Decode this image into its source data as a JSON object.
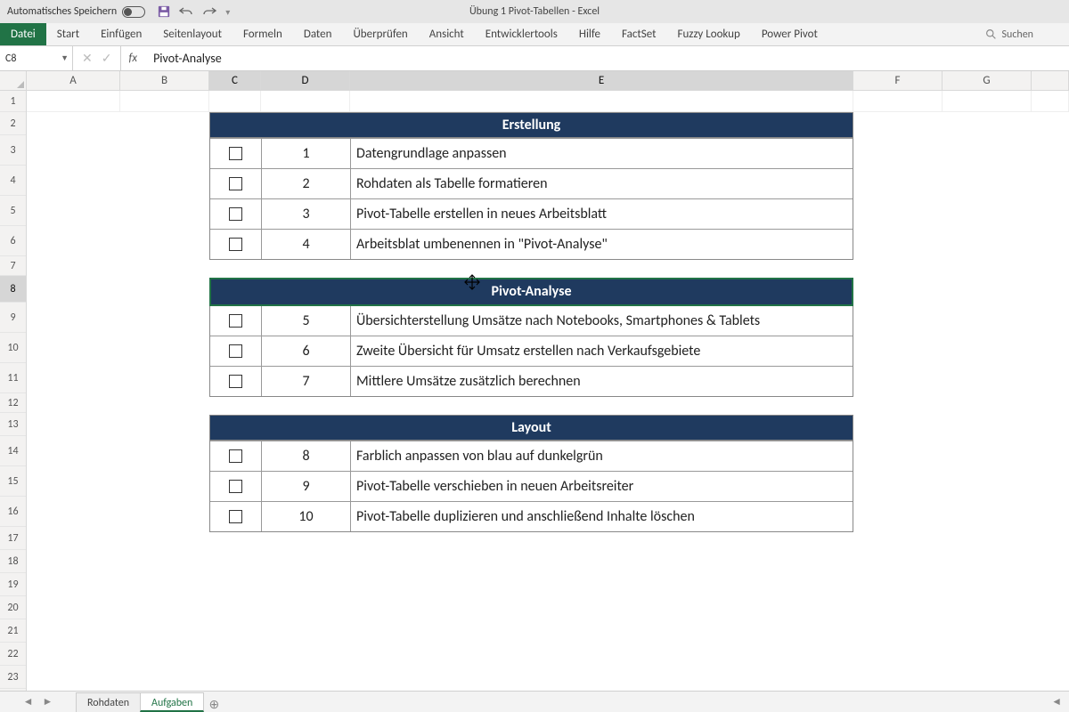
{
  "titlebar": {
    "autosave_label": "Automatisches Speichern",
    "autosave_on": false,
    "doc_title": "Übung 1 Pivot-Tabellen  -  Excel"
  },
  "ribbon": {
    "file_label": "Datei",
    "tabs": [
      "Start",
      "Einfügen",
      "Seitenlayout",
      "Formeln",
      "Daten",
      "Überprüfen",
      "Ansicht",
      "Entwicklertools",
      "Hilfe",
      "FactSet",
      "Fuzzy Lookup",
      "Power Pivot"
    ],
    "search_placeholder": "Suchen"
  },
  "formula": {
    "cell_ref": "C8",
    "value": "Pivot-Analyse"
  },
  "columns": [
    "A",
    "B",
    "C",
    "D",
    "E",
    "F",
    "G"
  ],
  "rows": [
    "1",
    "2",
    "3",
    "4",
    "5",
    "6",
    "7",
    "8",
    "9",
    "10",
    "11",
    "12",
    "13",
    "14",
    "15",
    "16",
    "17",
    "18",
    "19",
    "20",
    "21",
    "22",
    "23"
  ],
  "tables": {
    "t1": {
      "title": "Erstellung",
      "rows": [
        {
          "num": "1",
          "text": "Datengrundlage anpassen"
        },
        {
          "num": "2",
          "text": "Rohdaten als Tabelle formatieren"
        },
        {
          "num": "3",
          "text": "Pivot-Tabelle erstellen in neues Arbeitsblatt"
        },
        {
          "num": "4",
          "text": "Arbeitsblat umbenennen in \"Pivot-Analyse\""
        }
      ]
    },
    "t2": {
      "title": "Pivot-Analyse",
      "rows": [
        {
          "num": "5",
          "text": "Übersichterstellung Umsätze nach Notebooks, Smartphones & Tablets"
        },
        {
          "num": "6",
          "text": "Zweite Übersicht für Umsatz erstellen nach Verkaufsgebiete"
        },
        {
          "num": "7",
          "text": "Mittlere Umsätze zusätzlich berechnen"
        }
      ]
    },
    "t3": {
      "title": "Layout",
      "rows": [
        {
          "num": "8",
          "text": "Farblich anpassen von blau auf dunkelgrün"
        },
        {
          "num": "9",
          "text": "Pivot-Tabelle verschieben in neuen Arbeitsreiter"
        },
        {
          "num": "10",
          "text": "Pivot-Tabelle duplizieren und anschließend Inhalte löschen"
        }
      ]
    }
  },
  "sheets": {
    "items": [
      "Rohdaten",
      "Aufgaben"
    ],
    "active_index": 1
  }
}
